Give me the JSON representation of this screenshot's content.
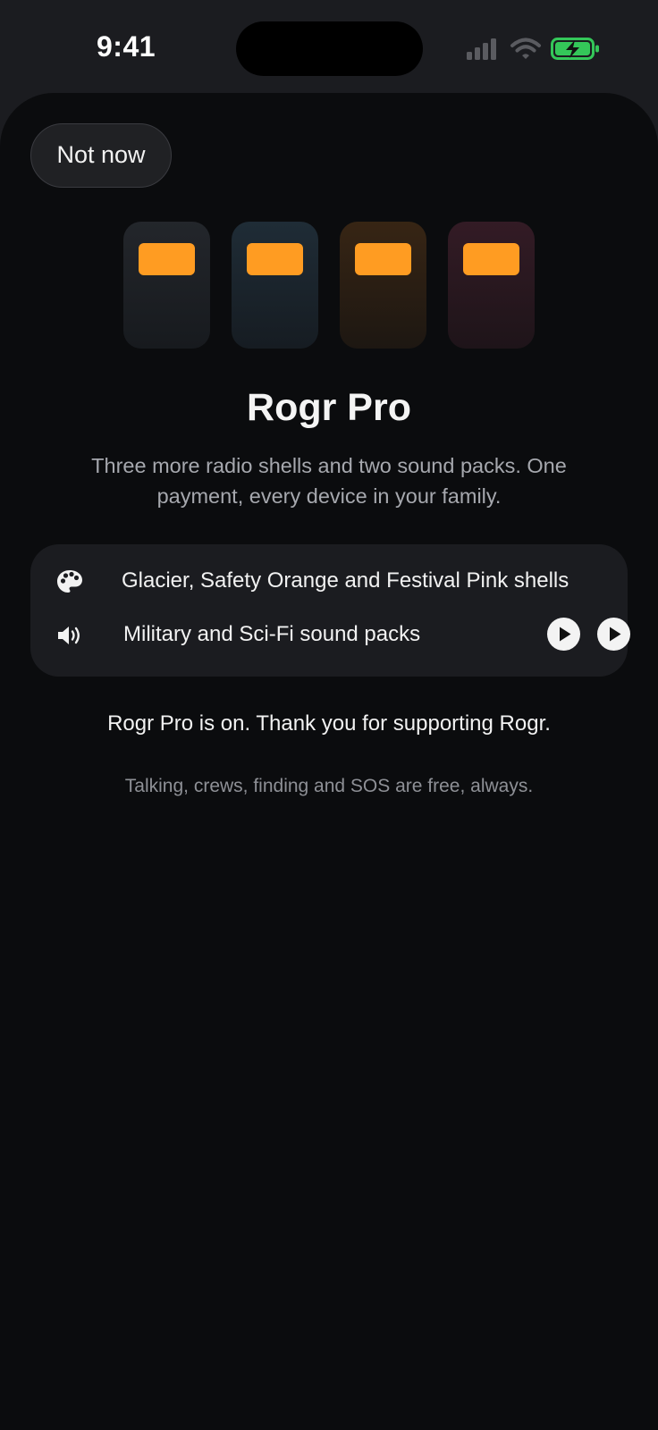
{
  "status_bar": {
    "time": "9:41",
    "icons": [
      "cellular-signal-icon",
      "wifi-icon",
      "battery-charging-icon"
    ],
    "battery_color": "#34c759"
  },
  "sheet": {
    "dismiss_label": "Not now",
    "shells": [
      {
        "name": "shell-default",
        "body_color": "#1c1f24",
        "screen_color": "#ff9c22"
      },
      {
        "name": "shell-glacier",
        "body_color": "#1f2a33",
        "screen_color": "#ff9c22"
      },
      {
        "name": "shell-safety-orange",
        "body_color": "#2e2116",
        "screen_color": "#ff9c22"
      },
      {
        "name": "shell-festival-pink",
        "body_color": "#2d1a23",
        "screen_color": "#ff9c22"
      }
    ],
    "title": "Rogr Pro",
    "subtitle": "Three more radio shells and two sound packs. One payment, every device in your family.",
    "features": [
      {
        "icon": "palette-icon",
        "text": "Glacier, Safety Orange and Festival Pink shells"
      },
      {
        "icon": "speaker-icon",
        "text": "Military and Sci-Fi sound packs",
        "actions": [
          "play-icon",
          "play-icon"
        ]
      }
    ],
    "thanks": "Rogr Pro is on. Thank you for supporting Rogr.",
    "footnote": "Talking, crews, finding and SOS are free, always."
  },
  "colors": {
    "background": "#0b0c0e",
    "card": "#1b1c20",
    "accent": "#ff9c22"
  }
}
